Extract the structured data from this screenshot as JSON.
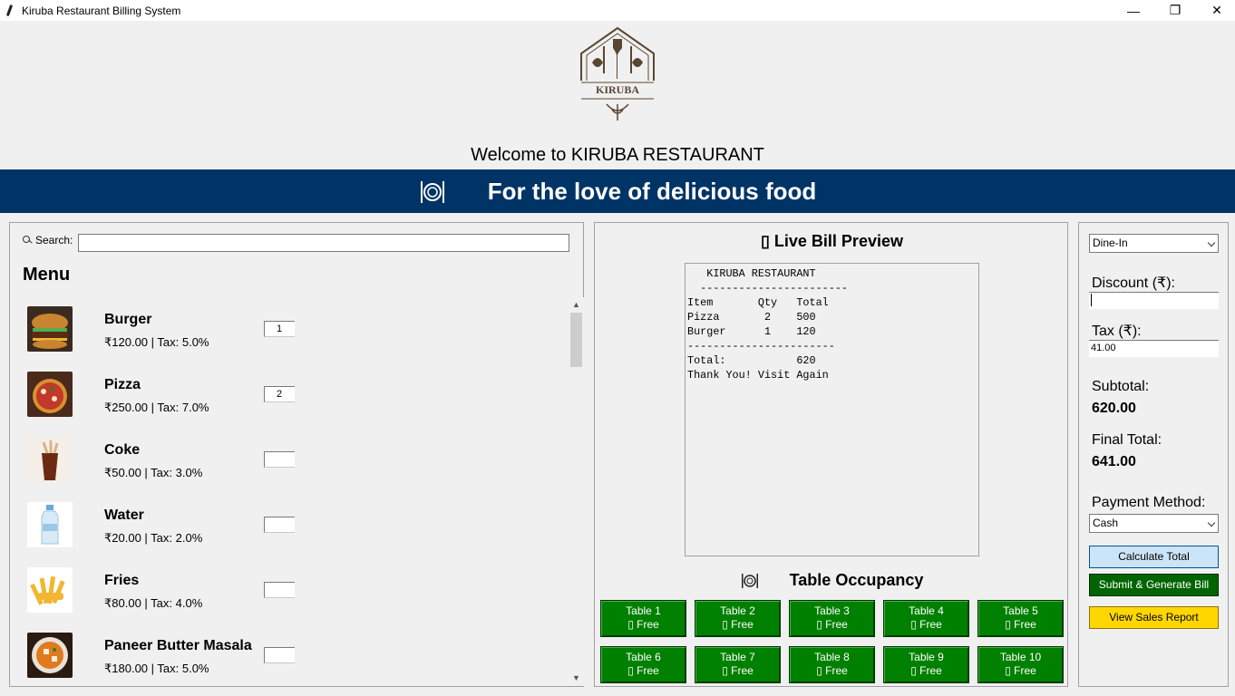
{
  "window": {
    "title": "Kiruba Restaurant Billing System",
    "controls": {
      "minimize": "—",
      "maximize": "❐",
      "close": "✕"
    }
  },
  "header": {
    "logo_text": "KIRUBA",
    "welcome": "Welcome to KIRUBA RESTAURANT",
    "slogan": "For the love of delicious food",
    "banner_icon": "plate-cutlery-icon"
  },
  "menu": {
    "search_label": "Search:",
    "search_value": "",
    "heading": "Menu",
    "items": [
      {
        "name": "Burger",
        "price_line": "₹120.00  |  Tax: 5.0%",
        "qty": "1",
        "icon": "burger-icon"
      },
      {
        "name": "Pizza",
        "price_line": "₹250.00  |  Tax: 7.0%",
        "qty": "2",
        "icon": "pizza-icon"
      },
      {
        "name": "Coke",
        "price_line": "₹50.00  |  Tax: 3.0%",
        "qty": "",
        "icon": "coke-icon"
      },
      {
        "name": "Water",
        "price_line": "₹20.00  |  Tax: 2.0%",
        "qty": "",
        "icon": "water-bottle-icon"
      },
      {
        "name": "Fries",
        "price_line": "₹80.00  |  Tax: 4.0%",
        "qty": "",
        "icon": "fries-icon"
      },
      {
        "name": "Paneer Butter Masala",
        "price_line": "₹180.00  |  Tax: 5.0%",
        "qty": "",
        "icon": "curry-bowl-icon"
      }
    ]
  },
  "bill": {
    "heading": "▯ Live Bill Preview",
    "preview_text": "   KIRUBA RESTAURANT\n  -----------------------\nItem       Qty   Total\nPizza       2    500\nBurger      1    120\n-----------------------\nTotal:           620\nThank You! Visit Again",
    "occupancy_title": "Table Occupancy",
    "tables": [
      {
        "name": "Table 1",
        "status": "▯ Free"
      },
      {
        "name": "Table 2",
        "status": "▯ Free"
      },
      {
        "name": "Table 3",
        "status": "▯ Free"
      },
      {
        "name": "Table 4",
        "status": "▯ Free"
      },
      {
        "name": "Table 5",
        "status": "▯ Free"
      },
      {
        "name": "Table 6",
        "status": "▯ Free"
      },
      {
        "name": "Table 7",
        "status": "▯ Free"
      },
      {
        "name": "Table 8",
        "status": "▯ Free"
      },
      {
        "name": "Table 9",
        "status": "▯ Free"
      },
      {
        "name": "Table 10",
        "status": "▯ Free"
      }
    ]
  },
  "side": {
    "order_type": "Dine-In",
    "discount_label": "Discount (₹):",
    "discount_value": "",
    "tax_label": "Tax (₹):",
    "tax_value": "41.00",
    "subtotal_label": "Subtotal:",
    "subtotal_value": "620.00",
    "final_label": "Final Total:",
    "final_value": "641.00",
    "payment_label": "Payment Method:",
    "payment_value": "Cash",
    "calc_button": "Calculate Total",
    "submit_button": "Submit & Generate Bill",
    "report_button": "View Sales Report"
  },
  "colors": {
    "banner": "#003366",
    "table_free": "#008000",
    "submit": "#006400",
    "report": "#ffd700",
    "calc": "#cce4f7"
  }
}
